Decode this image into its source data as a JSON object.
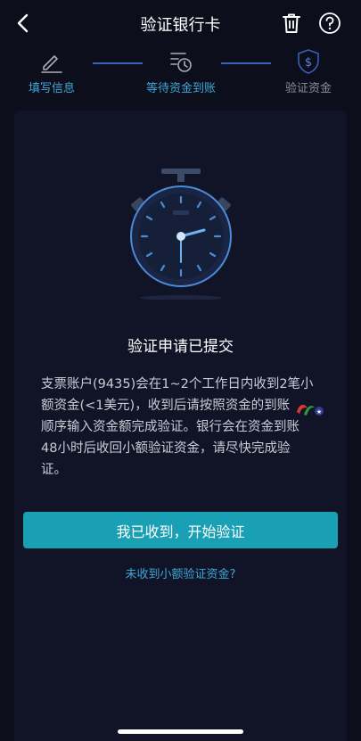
{
  "header": {
    "title": "验证银行卡",
    "back_icon": "chevron-left-icon",
    "trash_icon": "trash-icon",
    "help_icon": "help-circle-icon"
  },
  "steps": [
    {
      "label": "填写信息",
      "icon": "edit-icon",
      "state": "active"
    },
    {
      "label": "等待资金到账",
      "icon": "list-clock-icon",
      "state": "active"
    },
    {
      "label": "验证资金",
      "icon": "dollar-shield-icon",
      "state": "inactive"
    }
  ],
  "main": {
    "illustration_icon": "stopwatch-icon",
    "title": "验证申请已提交",
    "description_lines": [
      "支票账户(9435)会在1~2个工作日内收到2笔小",
      "额资金(<1美元)，收到后请按照资金的到账",
      "顺序输入资金额完成验证。银行会在资金到账",
      "48小时后收回小额验证资金，请尽快完成验",
      "证。"
    ],
    "primary_button": "我已收到，开始验证",
    "secondary_link": "未收到小额验证资金?"
  },
  "colors": {
    "background": "#0c0e1b",
    "card": "#111427",
    "accent": "#3fa7d8",
    "button": "#1aa0b4",
    "inactive": "#8b8f9c"
  }
}
